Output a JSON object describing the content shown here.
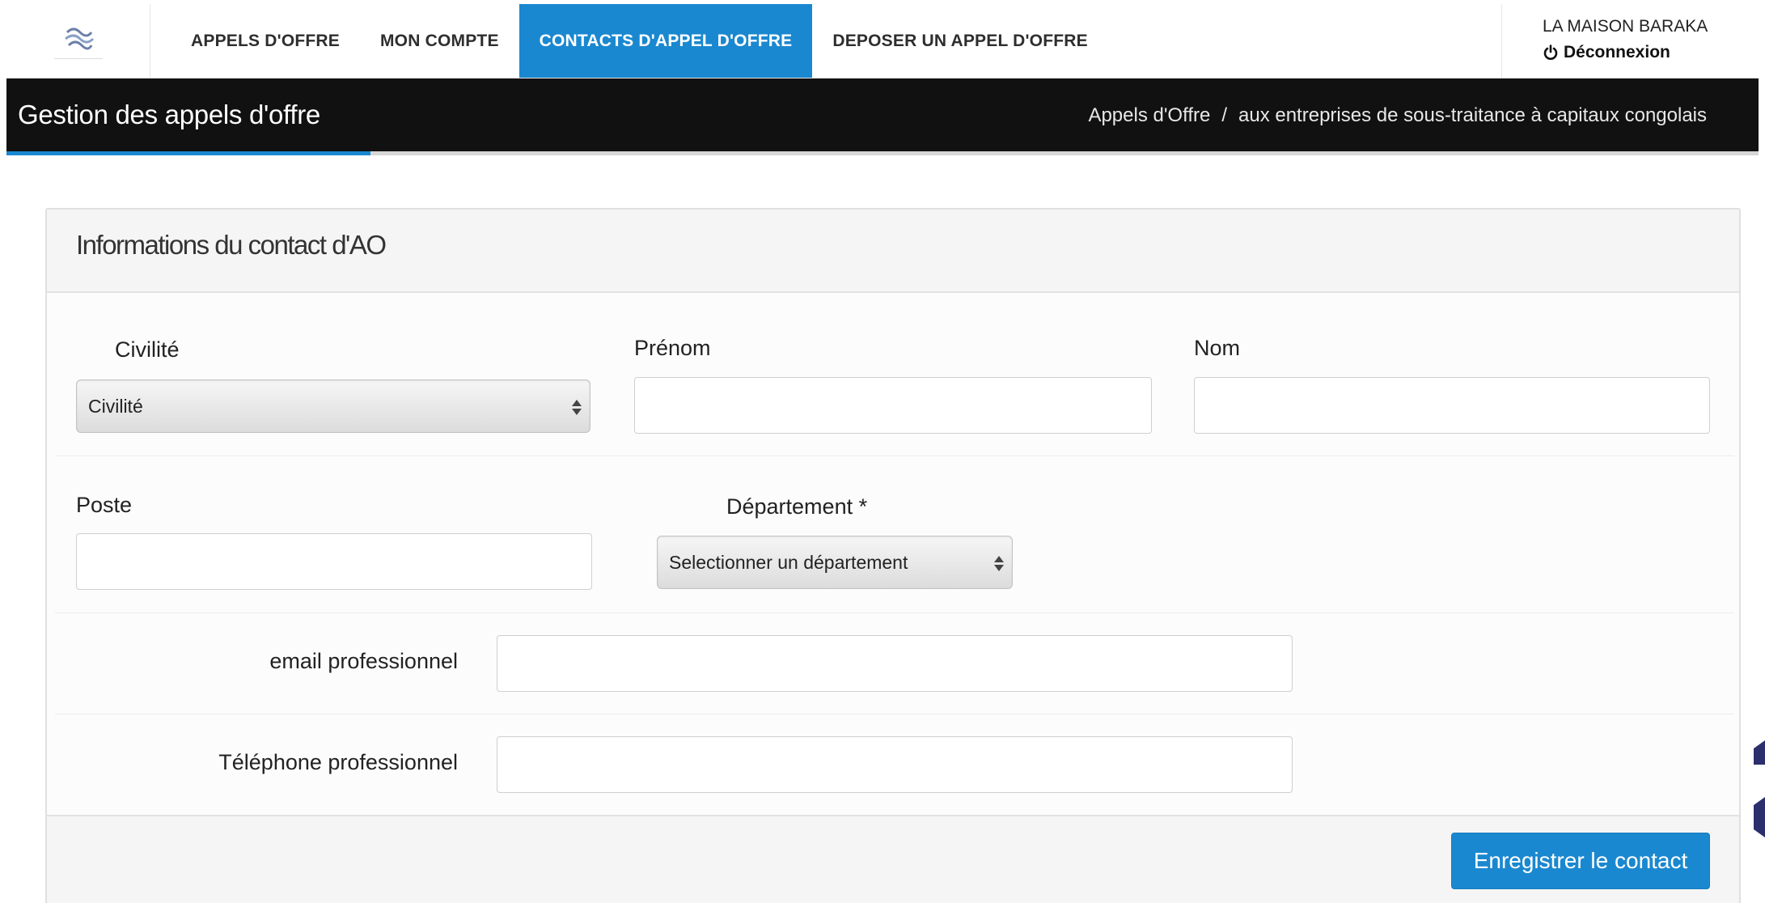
{
  "nav": {
    "links": [
      {
        "label": "APPELS D'OFFRE"
      },
      {
        "label": "MON COMPTE"
      },
      {
        "label": "CONTACTS D'APPEL D'OFFRE",
        "active": true
      },
      {
        "label": "DEPOSER UN APPEL D'OFFRE"
      }
    ],
    "user_name": "LA MAISON BARAKA",
    "logout_label": "Déconnexion"
  },
  "header": {
    "title": "Gestion des appels d'offre",
    "breadcrumb": [
      "Appels d'Offre",
      "aux entreprises de sous-traitance à capitaux congolais"
    ],
    "breadcrumb_separator": "/"
  },
  "form": {
    "panel_title": "Informations du contact d'AO",
    "civilite": {
      "label": "Civilité",
      "selected": "Civilité"
    },
    "prenom": {
      "label": "Prénom",
      "value": ""
    },
    "nom": {
      "label": "Nom",
      "value": ""
    },
    "poste": {
      "label": "Poste",
      "value": ""
    },
    "departement": {
      "label": "Département *",
      "selected": "Selectionner un département"
    },
    "email": {
      "label": "email professionnel",
      "value": ""
    },
    "telephone": {
      "label": "Téléphone professionnel",
      "value": ""
    },
    "save_label": "Enregistrer le contact"
  },
  "colors": {
    "accent": "#1a88d0",
    "header_bg": "#111111"
  },
  "icons": {
    "logo": "company-logo-icon",
    "logout": "power-icon",
    "select": "updown-arrows-icon"
  }
}
